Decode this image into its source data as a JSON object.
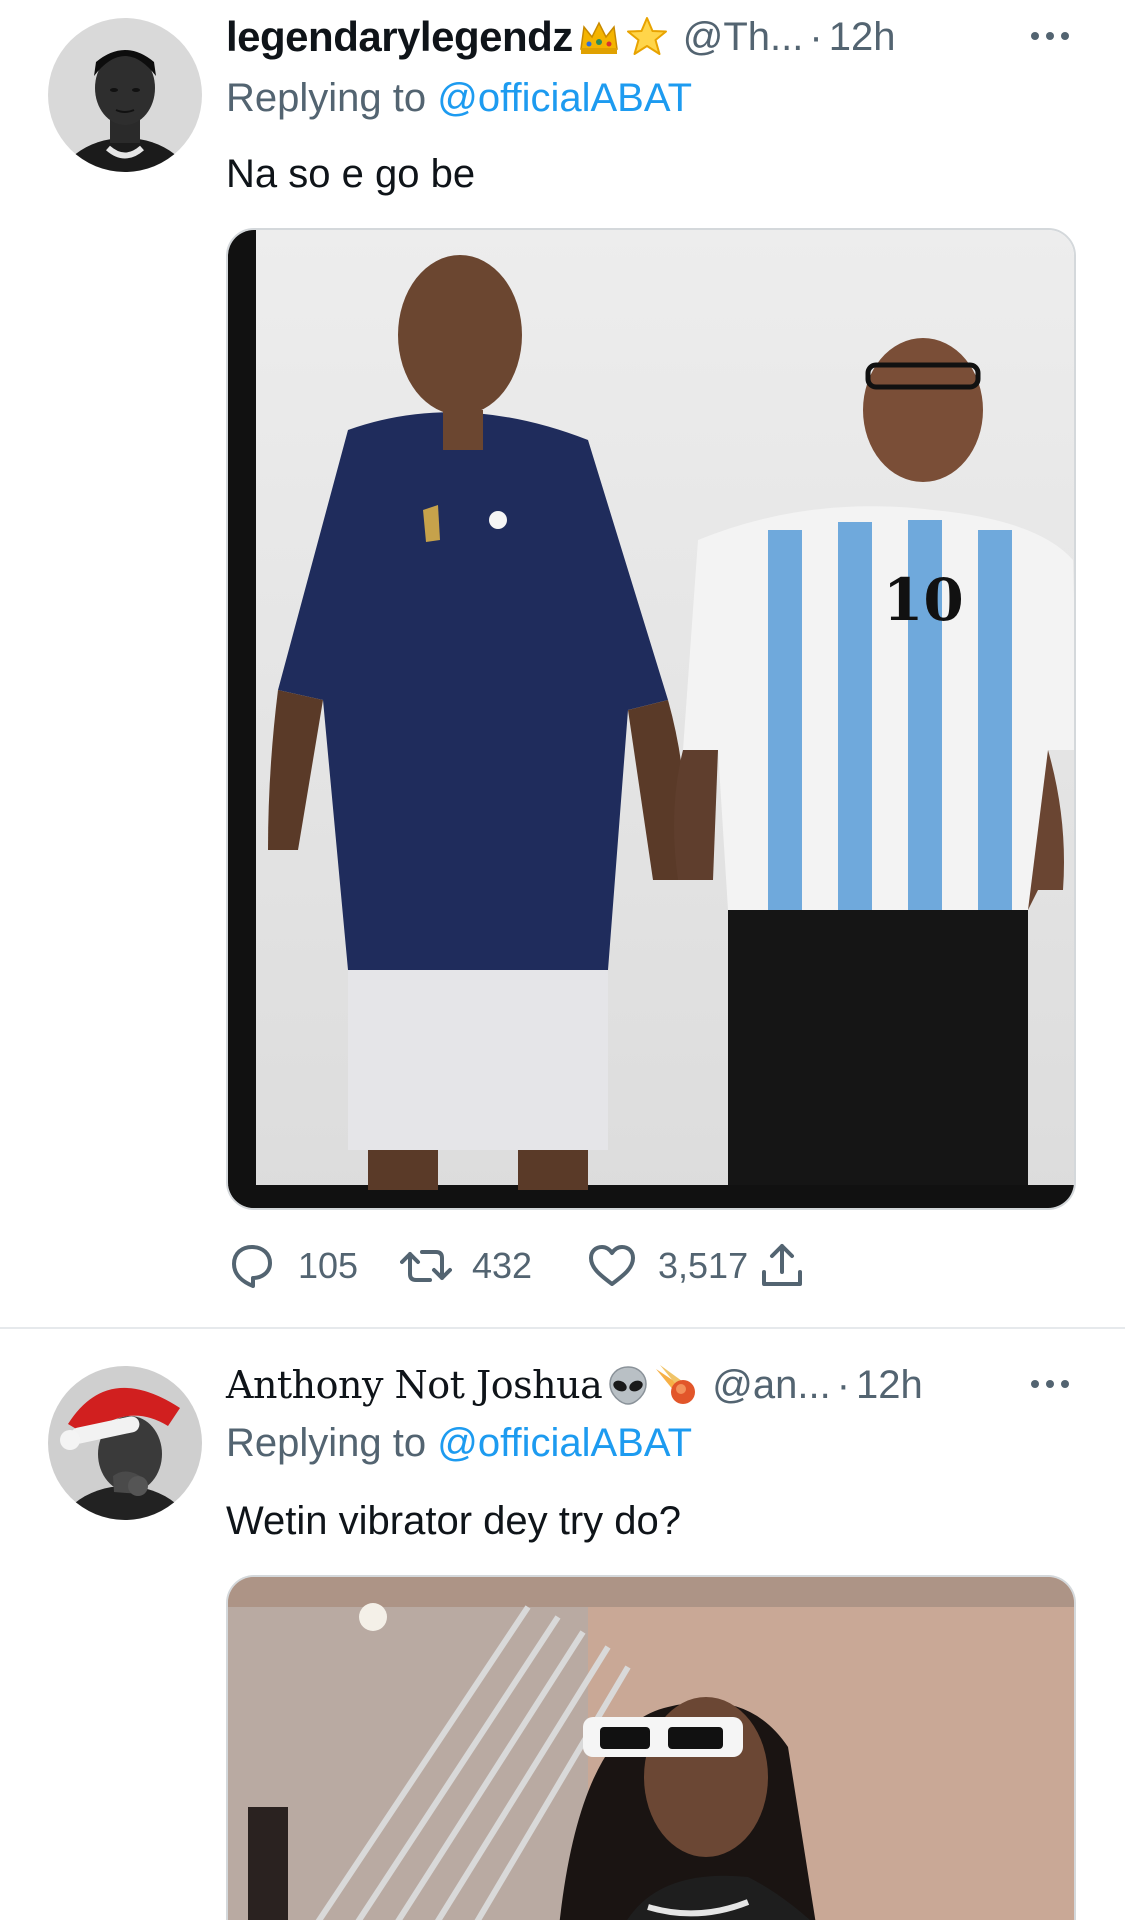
{
  "tweets": [
    {
      "display_name": "legendarylegendz",
      "name_emojis": [
        "crown-emoji",
        "star-emoji"
      ],
      "handle": "@Th...",
      "separator": "·",
      "time": "12h",
      "replying_prefix": "Replying to ",
      "replying_to": "@officialABAT",
      "text": "Na so e go be",
      "media": {
        "kind": "photo",
        "description_icon": "photo-image",
        "left_jersey_number": "",
        "right_jersey_number": "10"
      },
      "actions": {
        "replies": "105",
        "retweets": "432",
        "likes": "3,517"
      }
    },
    {
      "display_name": "Anthony Not Joshua",
      "name_emojis": [
        "alien-emoji",
        "comet-emoji"
      ],
      "handle": "@an...",
      "separator": "·",
      "time": "12h",
      "replying_prefix": "Replying to ",
      "replying_to": "@officialABAT",
      "text": "Wetin vibrator dey try do?",
      "media": {
        "kind": "photo",
        "description_icon": "photo-image"
      }
    }
  ],
  "icons": {
    "reply": "reply-icon",
    "retweet": "retweet-icon",
    "like": "heart-icon",
    "share": "share-icon",
    "more": "more-dots-icon"
  },
  "colors": {
    "text_primary": "#0f1419",
    "text_secondary": "#536471",
    "link": "#1d9bf0",
    "divider": "#e6e9ec"
  }
}
